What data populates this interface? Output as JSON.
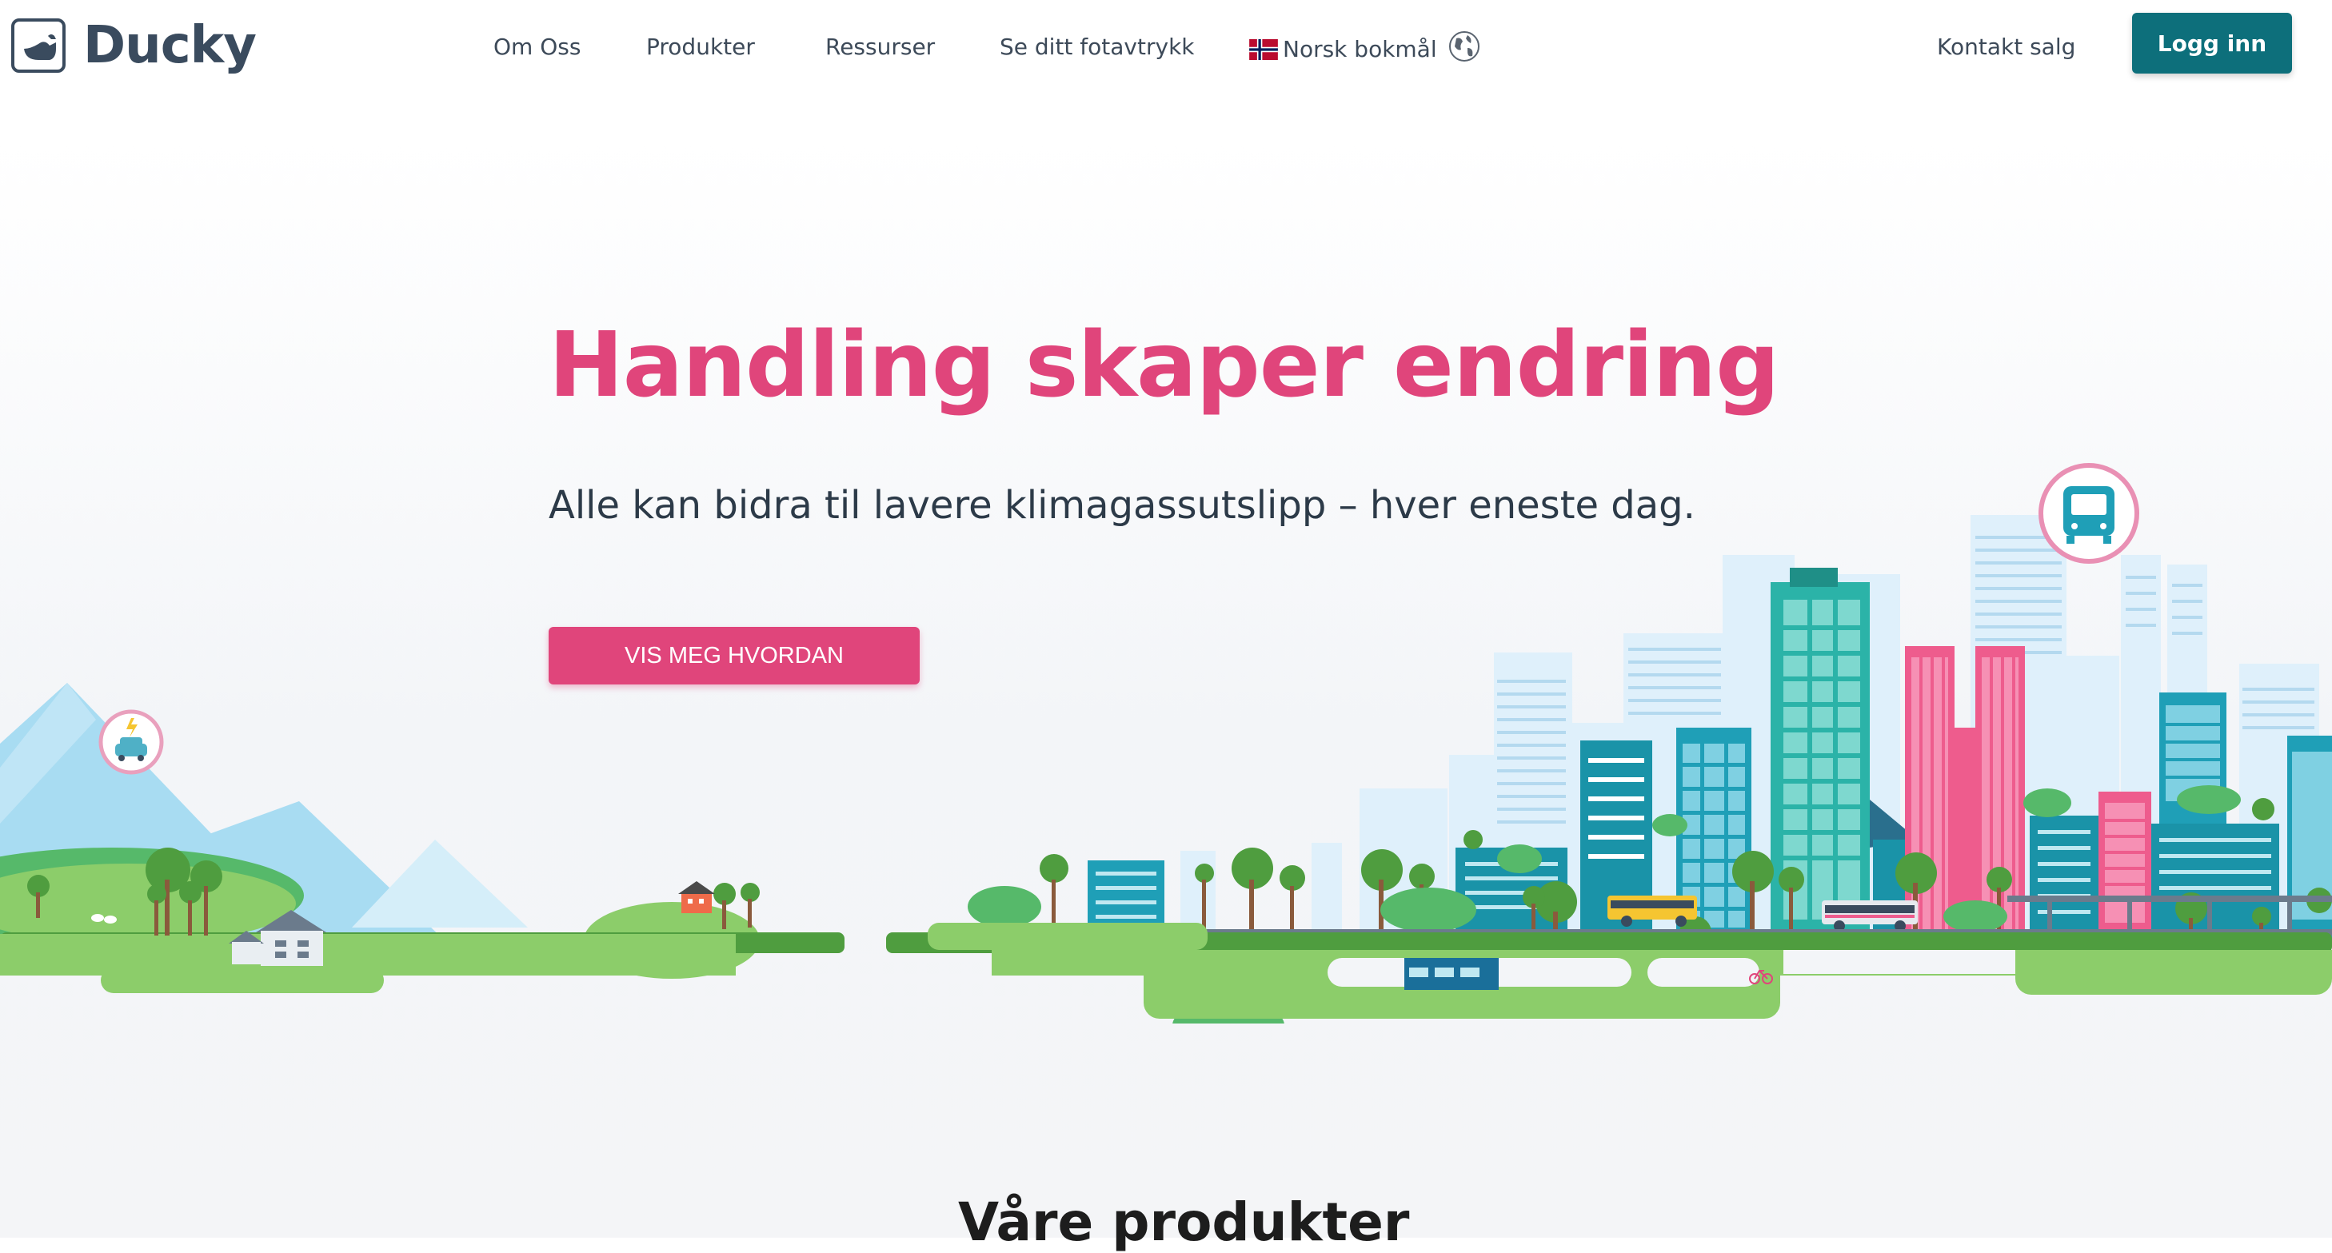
{
  "brand": {
    "name": "Ducky"
  },
  "nav": {
    "items": [
      "Om Oss",
      "Produkter",
      "Ressurser",
      "Se ditt fotavtrykk"
    ],
    "language": "Norsk bokmål",
    "contact": "Kontakt salg",
    "login": "Logg inn"
  },
  "hero": {
    "title": "Handling skaper endring",
    "subtitle": "Alle kan bidra til lavere klimagassutslipp – hver eneste dag.",
    "cta": "VIS MEG HVORDAN"
  },
  "section": {
    "title": "Våre produkter"
  },
  "colors": {
    "brand": "#3a4b5e",
    "accent_pink": "#e0457b",
    "primary_teal": "#0d6f7b",
    "grass": "#5aa84b",
    "sky_building": "#dff0fb"
  },
  "icons": [
    "duck-logo-icon",
    "norway-flag-icon",
    "globe-icon",
    "electric-car-icon",
    "bus-icon",
    "bicycle-icon"
  ]
}
